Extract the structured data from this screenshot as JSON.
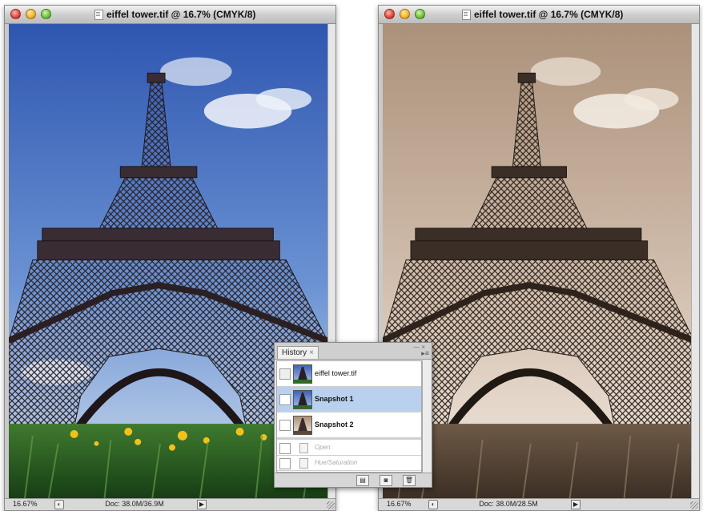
{
  "windows": {
    "left": {
      "title": "eiffel tower.tif @ 16.7% (CMYK/8)",
      "zoom": "16.67%",
      "doc_size": "Doc: 38.0M/36.9M"
    },
    "right": {
      "title": "eiffel tower.tif @ 16.7% (CMYK/8)",
      "zoom": "16.67%",
      "doc_size": "Doc: 38.0M/28.5M"
    }
  },
  "history_panel": {
    "tab_label": "History",
    "tab_close": "×",
    "snapshots": [
      {
        "label": "eiffel tower.tif",
        "selected": false
      },
      {
        "label": "Snapshot 1",
        "selected": true
      },
      {
        "label": "Snapshot 2",
        "selected": false
      }
    ],
    "states": [
      {
        "label": "Open"
      },
      {
        "label": "Hue/Saturation"
      }
    ]
  },
  "colors": {
    "sky_top": "#3d63b8",
    "sky_bottom": "#c6d7ec",
    "sepia_top": "#b59c84",
    "sepia_bottom": "#f0e6dc",
    "selection": "#b9d1ee"
  },
  "icons": [
    "document-icon",
    "history-brush-icon",
    "new-document-icon",
    "camera-icon",
    "trash-icon",
    "panel-menu-icon"
  ]
}
